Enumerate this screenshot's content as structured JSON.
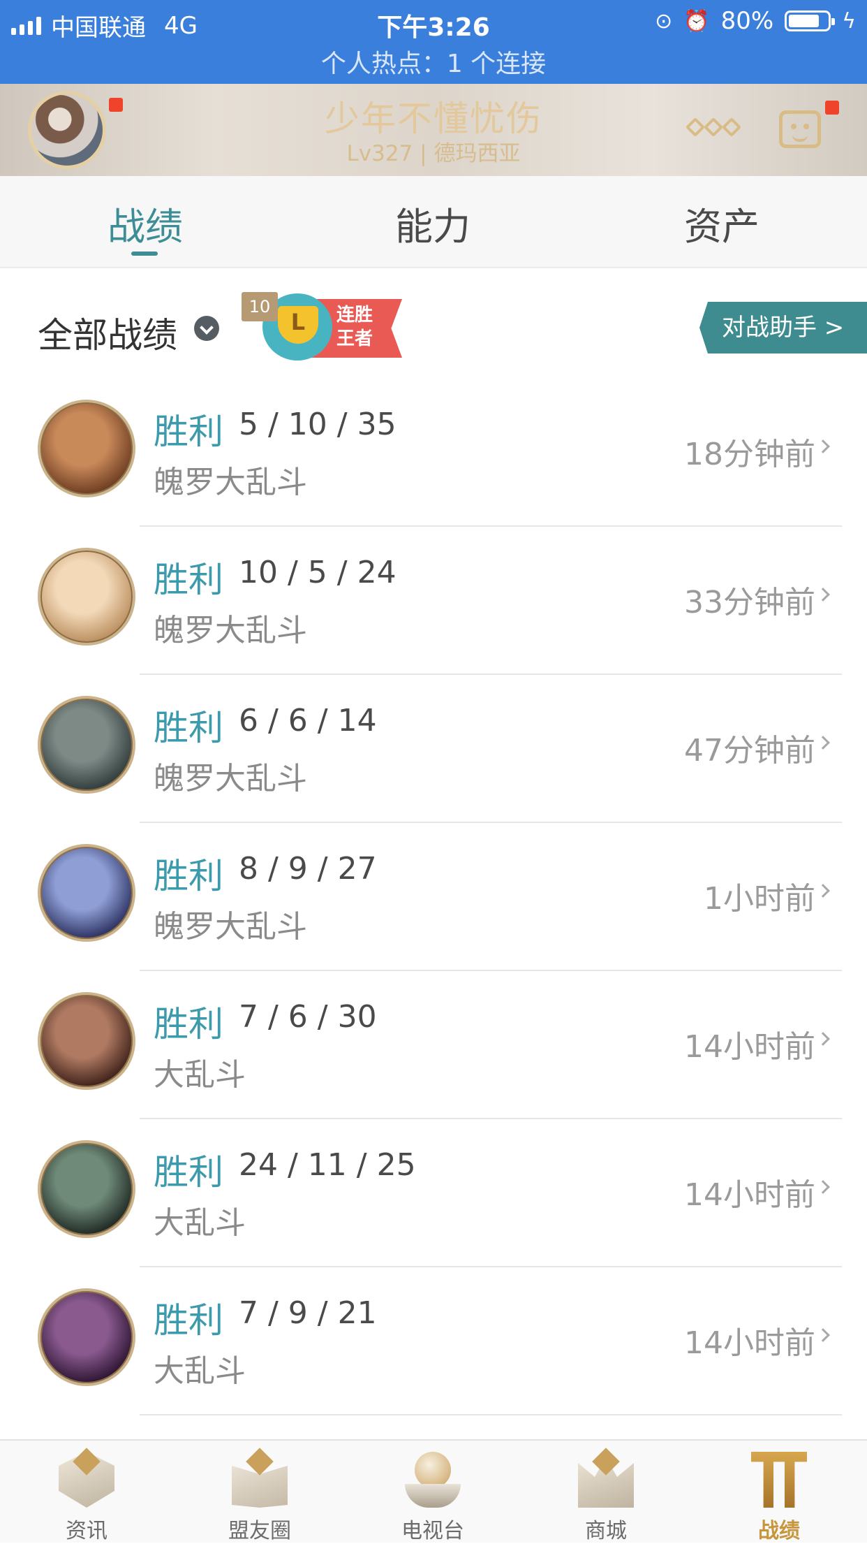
{
  "status_bar": {
    "carrier": "中国联通",
    "network": "4G",
    "time": "下午3:26",
    "battery": "80%",
    "battery_level": 0.8,
    "hotspot_text": "个人热点：1 个连接"
  },
  "header": {
    "username": "少年不懂忧伤",
    "level_server": "Lv327 | 德玛西亚"
  },
  "tabs": [
    {
      "label": "战绩",
      "active": true
    },
    {
      "label": "能力",
      "active": false
    },
    {
      "label": "资产",
      "active": false
    }
  ],
  "filter": {
    "label": "全部战绩",
    "streak_count": "10",
    "streak_title_line1": "连胜",
    "streak_title_line2": "王者",
    "trophy_letter": "L",
    "assistant_button": "对战助手 >"
  },
  "matches": [
    {
      "result": "胜利",
      "kda": "5 / 10 / 35",
      "mode": "魄罗大乱斗",
      "time": "18分钟前",
      "hero_colors": [
        "#c98a5a",
        "#6b3a20"
      ]
    },
    {
      "result": "胜利",
      "kda": "10 / 5 / 24",
      "mode": "魄罗大乱斗",
      "time": "33分钟前",
      "hero_colors": [
        "#f3d9b8",
        "#b98d5e"
      ]
    },
    {
      "result": "胜利",
      "kda": "6 / 6 / 14",
      "mode": "魄罗大乱斗",
      "time": "47分钟前",
      "hero_colors": [
        "#7d8a86",
        "#2f3a3a"
      ]
    },
    {
      "result": "胜利",
      "kda": "8 / 9 / 27",
      "mode": "魄罗大乱斗",
      "time": "1小时前",
      "hero_colors": [
        "#8f9fd6",
        "#2a2f5e"
      ]
    },
    {
      "result": "胜利",
      "kda": "7 / 6 / 30",
      "mode": "大乱斗",
      "time": "14小时前",
      "hero_colors": [
        "#b07a62",
        "#3b1f18"
      ]
    },
    {
      "result": "胜利",
      "kda": "24 / 11 / 25",
      "mode": "大乱斗",
      "time": "14小时前",
      "hero_colors": [
        "#6f8a78",
        "#1c2622"
      ]
    },
    {
      "result": "胜利",
      "kda": "7 / 9 / 21",
      "mode": "大乱斗",
      "time": "14小时前",
      "hero_colors": [
        "#8a5a8f",
        "#2a1330"
      ]
    }
  ],
  "bottom_nav": [
    {
      "label": "资讯",
      "icon": "news-icon",
      "active": false
    },
    {
      "label": "盟友圈",
      "icon": "friends-icon",
      "active": false
    },
    {
      "label": "电视台",
      "icon": "tv-icon",
      "active": false
    },
    {
      "label": "商城",
      "icon": "shop-icon",
      "active": false
    },
    {
      "label": "战绩",
      "icon": "stats-icon",
      "active": true
    }
  ]
}
